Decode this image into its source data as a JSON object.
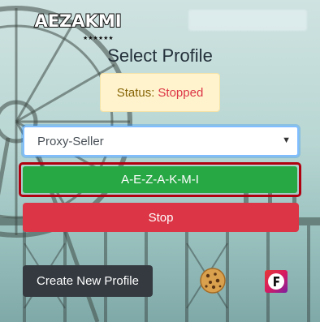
{
  "header": {
    "logo_text": "AEZAKMI",
    "logo_stars": "★★★★★★"
  },
  "title": "Select Profile",
  "status": {
    "label": "Status:",
    "value": "Stopped",
    "value_color": "#dc3545"
  },
  "profile_select": {
    "selected": "Proxy-Seller"
  },
  "buttons": {
    "start_label": "A-E-Z-A-K-M-I",
    "stop_label": "Stop",
    "create_label": "Create New Profile"
  },
  "icons": {
    "cookie": "cookie-icon",
    "f_logo": "f-logo-icon"
  },
  "colors": {
    "start": "#28a745",
    "stop": "#dc3545",
    "create": "#343a40",
    "status_bg": "#fff3cd"
  }
}
